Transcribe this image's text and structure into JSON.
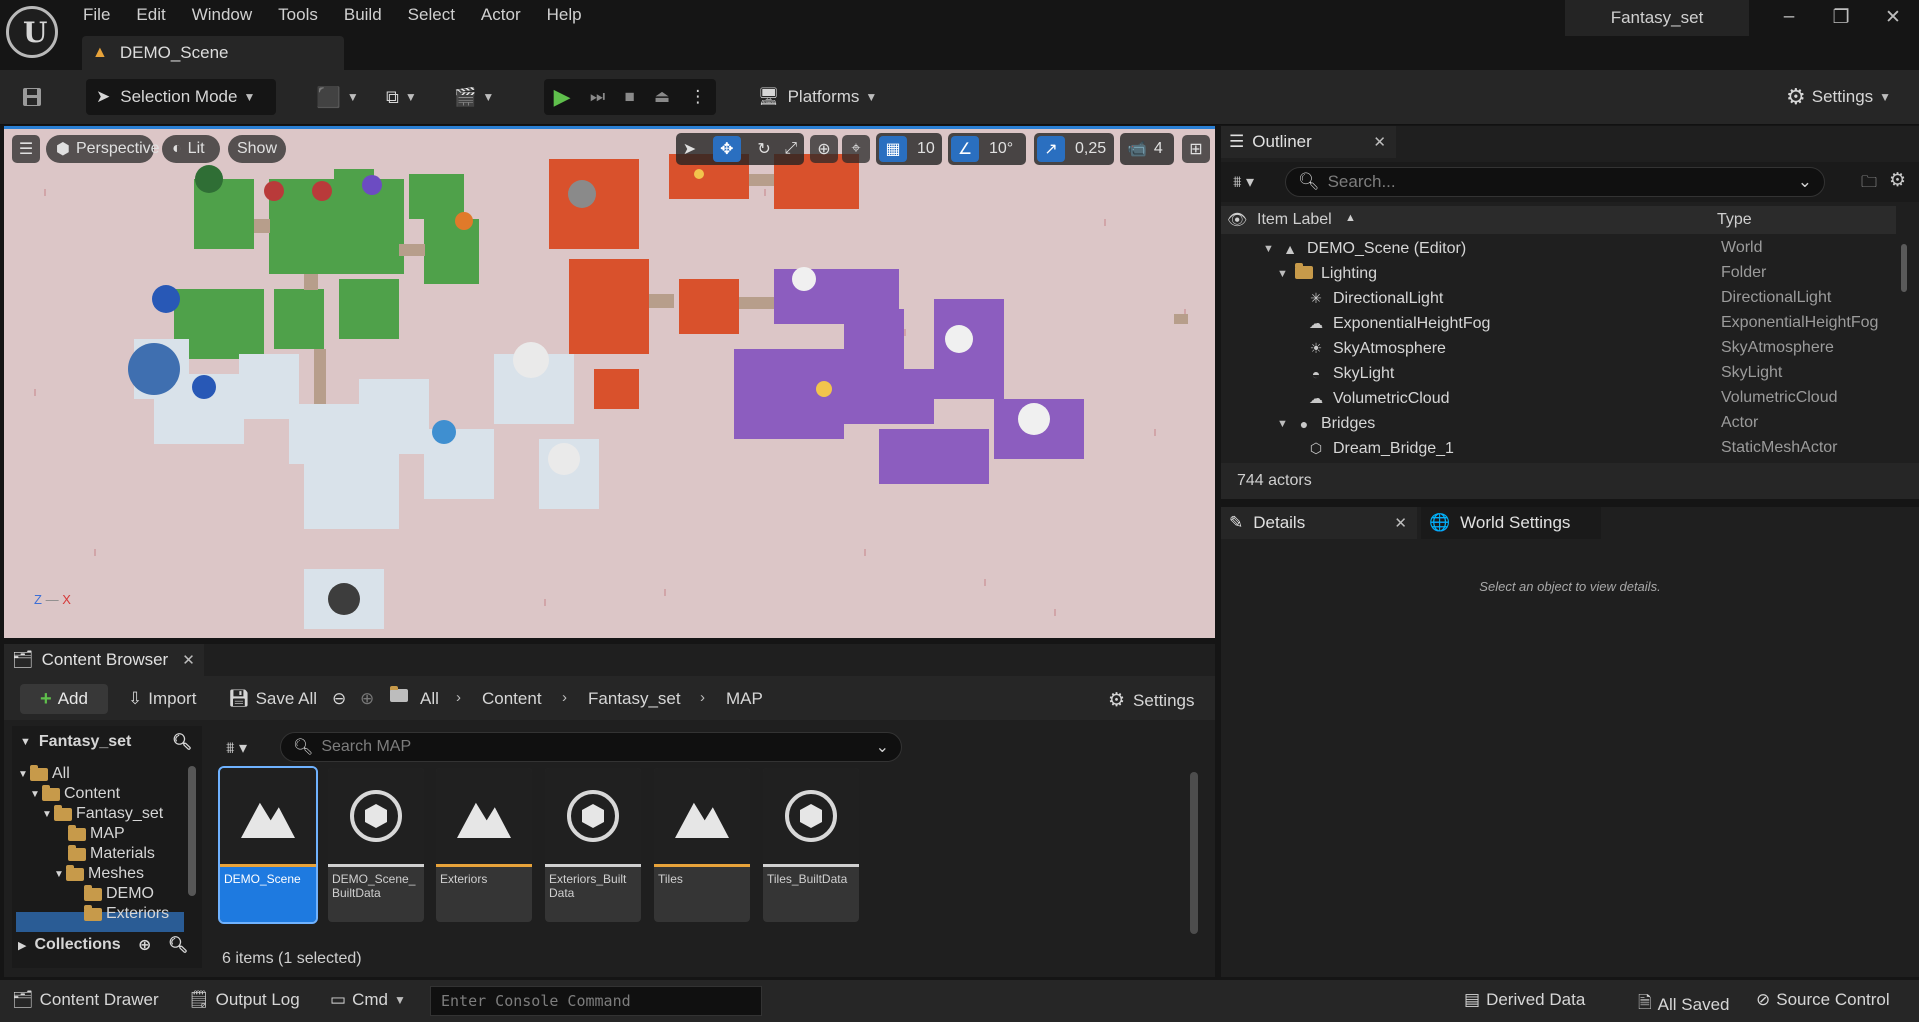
{
  "app": {
    "project_name": "Fantasy_set",
    "document_tab": "DEMO_Scene",
    "menu": [
      "File",
      "Edit",
      "Window",
      "Tools",
      "Build",
      "Select",
      "Actor",
      "Help"
    ]
  },
  "toolbar": {
    "mode_label": "Selection Mode",
    "platforms_label": "Platforms",
    "settings_label": "Settings"
  },
  "viewport": {
    "view_mode": "Perspective",
    "lighting_mode": "Lit",
    "show_label": "Show",
    "grid_snap": "10",
    "rotation_snap": "10°",
    "scale_snap": "0,25",
    "camera_speed": "4",
    "axis_z": "Z",
    "axis_x": "X"
  },
  "outliner": {
    "tab_label": "Outliner",
    "search_placeholder": "Search...",
    "col_label": "Item Label",
    "col_type": "Type",
    "rows": [
      {
        "label": "DEMO_Scene (Editor)",
        "type": "World"
      },
      {
        "label": "Lighting",
        "type": "Folder"
      },
      {
        "label": "DirectionalLight",
        "type": "DirectionalLight"
      },
      {
        "label": "ExponentialHeightFog",
        "type": "ExponentialHeightFog"
      },
      {
        "label": "SkyAtmosphere",
        "type": "SkyAtmosphere"
      },
      {
        "label": "SkyLight",
        "type": "SkyLight"
      },
      {
        "label": "VolumetricCloud",
        "type": "VolumetricCloud"
      },
      {
        "label": "Bridges",
        "type": "Actor"
      },
      {
        "label": "Dream_Bridge_1",
        "type": "StaticMeshActor"
      }
    ],
    "actor_count": "744 actors"
  },
  "details": {
    "tab_label": "Details",
    "world_settings_label": "World Settings",
    "hint": "Select an object to view details."
  },
  "content_browser": {
    "tab_label": "Content Browser",
    "add_label": "Add",
    "import_label": "Import",
    "save_all_label": "Save All",
    "breadcrumb": [
      "All",
      "Content",
      "Fantasy_set",
      "MAP"
    ],
    "settings_label": "Settings",
    "tree_root": "Fantasy_set",
    "tree": [
      "All",
      "Content",
      "Fantasy_set",
      "MAP",
      "Materials",
      "Meshes",
      "DEMO",
      "Exteriors"
    ],
    "collections_label": "Collections",
    "search_placeholder": "Search MAP",
    "assets": [
      {
        "name": "DEMO_Scene",
        "kind": "map"
      },
      {
        "name": "DEMO_Scene_ BuiltData",
        "kind": "data"
      },
      {
        "name": "Exteriors",
        "kind": "map"
      },
      {
        "name": "Exteriors_Built Data",
        "kind": "data"
      },
      {
        "name": "Tiles",
        "kind": "map"
      },
      {
        "name": "Tiles_BuiltData",
        "kind": "data"
      }
    ],
    "items_count": "6 items (1 selected)"
  },
  "statusbar": {
    "content_drawer": "Content Drawer",
    "output_log": "Output Log",
    "cmd": "Cmd",
    "console_placeholder": "Enter Console Command",
    "derived_data": "Derived Data",
    "all_saved": "All Saved",
    "source_control": "Source Control"
  },
  "colors": {
    "accent": "#2a6fc0",
    "play_green": "#5fbf4c",
    "map_stripe": "#e8a33a",
    "data_stripe": "#d0d0d0",
    "viewport_ground": "#dcc6c7"
  }
}
